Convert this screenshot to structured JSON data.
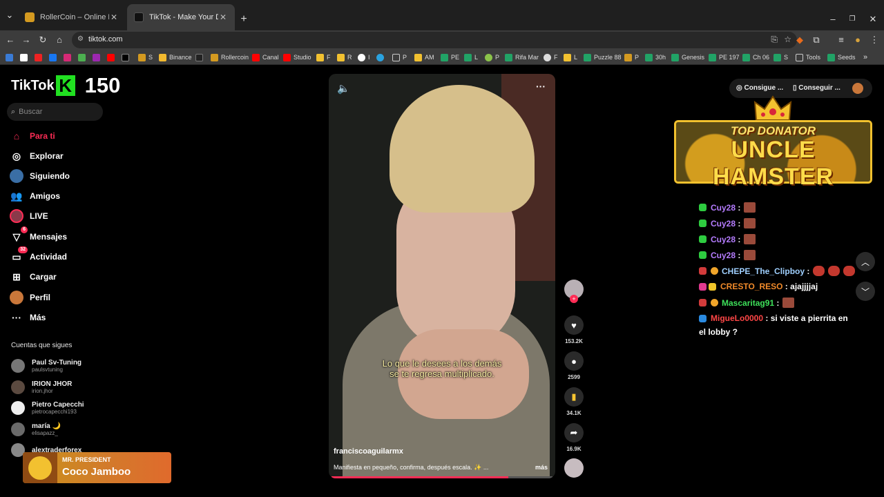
{
  "browser": {
    "tabs": [
      {
        "title": "RollerCoin – Online Bitcoin Min",
        "active": false
      },
      {
        "title": "TikTok - Make Your Day",
        "active": true
      }
    ],
    "url": "tiktok.com",
    "bookmarks": [
      "S",
      "Binance",
      "Rollercoin",
      "Canal",
      "Studio",
      "F",
      "R",
      "I",
      "P",
      "AM",
      "PE",
      "L",
      "P",
      "Rifa Mar",
      "F",
      "L",
      "Puzzle 88",
      "P",
      "30h",
      "Genesis",
      "PE 197",
      "Ch 06",
      "S",
      "Tools",
      "Seeds"
    ]
  },
  "sidebar": {
    "logo_text": "TikTok",
    "logo_k": "K",
    "counter": "150",
    "search_placeholder": "Buscar",
    "nav": [
      {
        "label": "Para ti",
        "icon": "home-icon"
      },
      {
        "label": "Explorar",
        "icon": "compass-icon"
      },
      {
        "label": "Siguiendo",
        "icon": "following-icon"
      },
      {
        "label": "Amigos",
        "icon": "friends-icon"
      },
      {
        "label": "LIVE",
        "icon": "live-icon"
      },
      {
        "label": "Mensajes",
        "icon": "messages-icon",
        "badge": "6"
      },
      {
        "label": "Actividad",
        "icon": "activity-icon",
        "badge": "32"
      },
      {
        "label": "Cargar",
        "icon": "upload-icon"
      },
      {
        "label": "Perfil",
        "icon": "profile-icon"
      },
      {
        "label": "Más",
        "icon": "more-icon"
      }
    ],
    "following_title": "Cuentas que sigues",
    "following": [
      {
        "name": "Paul Sv-Tuning",
        "handle": "paulsvtuning"
      },
      {
        "name": "IRION JHOR",
        "handle": "irion.jhor"
      },
      {
        "name": "Pietro Capecchi",
        "handle": "pietrocapecchi193"
      },
      {
        "name": "maría 🌙",
        "handle": "elisapazz_"
      },
      {
        "name": "alextraderforex",
        "handle": ""
      }
    ]
  },
  "music": {
    "artist": "MR. PRESIDENT",
    "song": "Coco Jamboo"
  },
  "video": {
    "caption_line1": "Lo que le desees a los demás",
    "caption_line2": "se te regresa multiplicado.",
    "username": "franciscoaguilarmx",
    "description": "Manifiesta en pequeño, confirma, después escala. ✨ ...",
    "more": "más",
    "progress": 0.8
  },
  "actions": {
    "likes": "153.2K",
    "comments": "2599",
    "saves": "34.1K",
    "shares": "16.9K"
  },
  "top_buttons": {
    "btn1": "Consigue ...",
    "btn2": "Conseguir ..."
  },
  "donator": {
    "title": "TOP DONATOR",
    "name": "UNCLE HAMSTER"
  },
  "chat": [
    {
      "user": "Cuy28",
      "user_color": "#b57cff",
      "text": ""
    },
    {
      "user": "Cuy28",
      "user_color": "#b57cff",
      "text": ""
    },
    {
      "user": "Cuy28",
      "user_color": "#b57cff",
      "text": ""
    },
    {
      "user": "Cuy28",
      "user_color": "#b57cff",
      "text": ""
    },
    {
      "user": "CHEPE_The_Clipboy",
      "user_color": "#9fd0ff",
      "text": ""
    },
    {
      "user": "CRESTO_RESO",
      "user_color": "#f08a2a",
      "text": "ajajjjjaj"
    },
    {
      "user": "Mascaritag91",
      "user_color": "#3ee05a",
      "text": ""
    },
    {
      "user": "MigueLo0000",
      "user_color": "#ff4646",
      "text": "si viste a pierrita en"
    },
    {
      "user": "",
      "user_color": "#ffffff",
      "text": "el lobby ?"
    }
  ],
  "colors": {
    "accent": "#fe2c55",
    "tiktok_k": "#21e021"
  }
}
